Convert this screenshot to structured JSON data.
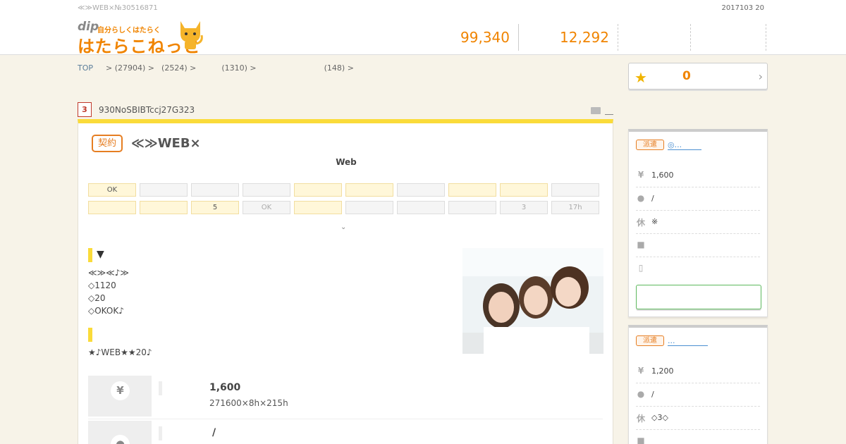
{
  "header": {
    "top_tag": "≪≫WEB×№30516871",
    "date": "2017103 20",
    "logo": {
      "dip": "dip",
      "tag": "自分らしくはたらく",
      "name": "はたらこねっと"
    },
    "stats": [
      "99,340",
      "12,292",
      "",
      ""
    ]
  },
  "breadcrumb": [
    "TOP",
    "> (27904) >",
    "(2524) >",
    "(1310) >",
    "(148) >"
  ],
  "favorite": {
    "count": "0"
  },
  "job": {
    "number": "3",
    "code": "930NoSBIBTccj27G323",
    "badge": "契約",
    "title": "≪≫WEB×",
    "subtitle": "Web",
    "tags_row1": [
      "OK",
      "",
      "",
      "",
      "",
      "",
      "",
      "",
      "",
      ""
    ],
    "tags_row2": [
      "",
      "",
      "5",
      "OK",
      "",
      "",
      "",
      "",
      "3",
      "17h"
    ],
    "more": "⌄",
    "section1_heading": "▼",
    "section1_lines": [
      "≪≫≪♪≫",
      "◇1120",
      "◇20",
      "◇OKOK♪"
    ],
    "section2_heading": "",
    "section2_lines": [
      "★♪WEB★★20♪"
    ],
    "info": [
      {
        "icon": "¥",
        "main": "1,600",
        "sub": "271600×8h×215h"
      },
      {
        "icon": "●",
        "main": "/",
        "sub": ""
      }
    ]
  },
  "sidebar": [
    {
      "badge": "派遣",
      "link": "◎...",
      "rows": [
        {
          "icon": "¥",
          "text": "1,600"
        },
        {
          "icon": "●",
          "text": "/"
        },
        {
          "icon": "休",
          "text": "※"
        },
        {
          "icon": "■",
          "text": ""
        },
        {
          "icon": "▯",
          "text": ""
        }
      ],
      "button": ""
    },
    {
      "badge": "派遣",
      "link": "...",
      "rows": [
        {
          "icon": "¥",
          "text": "1,200"
        },
        {
          "icon": "●",
          "text": "/"
        },
        {
          "icon": "休",
          "text": "◇3◇"
        },
        {
          "icon": "■",
          "text": ""
        }
      ]
    }
  ],
  "colors": {
    "accent": "#f08400",
    "yellow": "#fadb3a",
    "badge": "#e67e22",
    "link": "#4a8fd1",
    "button_border": "#5cb85c"
  }
}
